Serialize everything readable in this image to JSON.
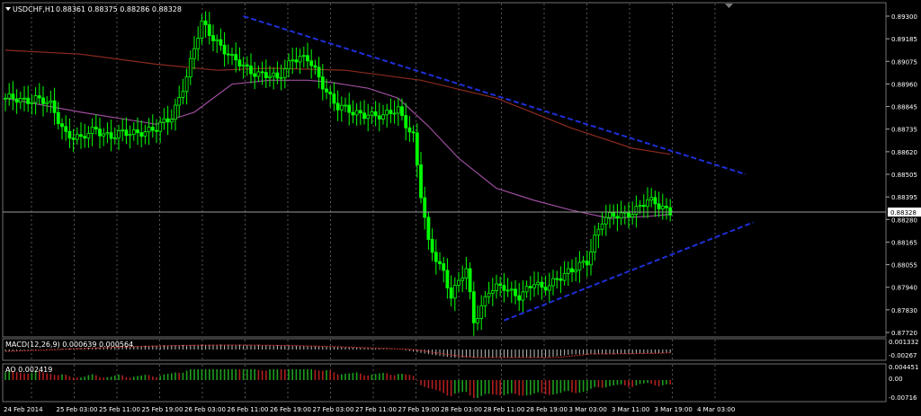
{
  "header": {
    "symbol_label": "USDCHF,H1",
    "ohlc": "0.88361 0.88375 0.88286 0.88328"
  },
  "price_axis": {
    "ticks": [
      "0.89300",
      "0.89185",
      "0.89075",
      "0.88960",
      "0.88845",
      "0.88735",
      "0.88620",
      "0.88505",
      "0.88395",
      "0.88280",
      "0.88165",
      "0.88055",
      "0.87940",
      "0.87830",
      "0.87720"
    ],
    "current_price": "0.88328"
  },
  "time_axis": {
    "ticks": [
      "24 Feb 2014",
      "25 Feb 03:00",
      "25 Feb 11:00",
      "25 Feb 19:00",
      "26 Feb 03:00",
      "26 Feb 11:00",
      "26 Feb 19:00",
      "27 Feb 03:00",
      "27 Feb 11:00",
      "27 Feb 19:00",
      "28 Feb 03:00",
      "28 Feb 11:00",
      "28 Feb 19:00",
      "3 Mar 03:00",
      "3 Mar 11:00",
      "3 Mar 19:00",
      "4 Mar 03:00"
    ]
  },
  "macd": {
    "label": "MACD(12,26,9) 0.000639 0.000564",
    "ticks": [
      "0.001332",
      "-0.00267"
    ]
  },
  "ao": {
    "label": "AO 0.002419",
    "ticks": [
      "0.004451",
      "0.00",
      "-0.00716"
    ]
  },
  "colors": {
    "background": "#000000",
    "bull": "#00ff00",
    "bear": "#00ff00",
    "ma_fast": "#9c4d9c",
    "ma_slow": "#8b2a1f",
    "trendline": "#1f2fd6",
    "grid": "#7a7a7a",
    "text": "#ffffff",
    "macd_hist": "#c0c0c0",
    "macd_signal": "#c0302a",
    "ao_up": "#1e9e1e",
    "ao_down": "#b01e1e"
  },
  "chart_data": {
    "type": "candlestick",
    "symbol": "USDCHF",
    "timeframe": "H1",
    "ylim": [
      0.8772,
      0.893
    ],
    "x": [
      "24 Feb 2014",
      "25 Feb 03:00",
      "25 Feb 11:00",
      "25 Feb 19:00",
      "26 Feb 03:00",
      "26 Feb 11:00",
      "26 Feb 19:00",
      "27 Feb 03:00",
      "27 Feb 11:00",
      "27 Feb 19:00",
      "28 Feb 03:00",
      "28 Feb 11:00",
      "28 Feb 19:00",
      "3 Mar 03:00",
      "3 Mar 11:00",
      "3 Mar 19:00",
      "4 Mar 03:00"
    ],
    "close_path": [
      [
        0,
        0.8888
      ],
      [
        8,
        0.8889
      ],
      [
        12,
        0.8885
      ],
      [
        16,
        0.8872
      ],
      [
        20,
        0.8868
      ],
      [
        24,
        0.8874
      ],
      [
        28,
        0.887
      ],
      [
        32,
        0.8871
      ],
      [
        36,
        0.8873
      ],
      [
        40,
        0.8873
      ],
      [
        44,
        0.888
      ],
      [
        48,
        0.89
      ],
      [
        52,
        0.8926
      ],
      [
        56,
        0.8918
      ],
      [
        60,
        0.8908
      ],
      [
        64,
        0.8904
      ],
      [
        68,
        0.8901
      ],
      [
        72,
        0.8898
      ],
      [
        76,
        0.891
      ],
      [
        80,
        0.8908
      ],
      [
        84,
        0.8896
      ],
      [
        88,
        0.8885
      ],
      [
        92,
        0.8881
      ],
      [
        96,
        0.8882
      ],
      [
        100,
        0.8879
      ],
      [
        104,
        0.8884
      ],
      [
        108,
        0.887
      ],
      [
        110,
        0.884
      ],
      [
        112,
        0.8816
      ],
      [
        116,
        0.8803
      ],
      [
        118,
        0.879
      ],
      [
        122,
        0.8803
      ],
      [
        124,
        0.8778
      ],
      [
        128,
        0.8793
      ],
      [
        132,
        0.8794
      ],
      [
        136,
        0.8791
      ],
      [
        140,
        0.8796
      ],
      [
        142,
        0.8793
      ],
      [
        146,
        0.88
      ],
      [
        150,
        0.8802
      ],
      [
        154,
        0.8808
      ],
      [
        156,
        0.882
      ],
      [
        158,
        0.8828
      ],
      [
        162,
        0.883
      ],
      [
        166,
        0.8833
      ],
      [
        170,
        0.8837
      ],
      [
        174,
        0.8835
      ],
      [
        176,
        0.8833
      ]
    ],
    "ma_fast": [
      [
        0,
        0.8889
      ],
      [
        20,
        0.8882
      ],
      [
        40,
        0.8876
      ],
      [
        50,
        0.8882
      ],
      [
        60,
        0.8896
      ],
      [
        70,
        0.8898
      ],
      [
        80,
        0.8898
      ],
      [
        86,
        0.8897
      ],
      [
        96,
        0.8894
      ],
      [
        104,
        0.8889
      ],
      [
        112,
        0.8875
      ],
      [
        120,
        0.8859
      ],
      [
        130,
        0.8844
      ],
      [
        140,
        0.8838
      ],
      [
        150,
        0.8833
      ],
      [
        160,
        0.8829
      ],
      [
        170,
        0.883
      ],
      [
        176,
        0.8831
      ]
    ],
    "ma_slow": [
      [
        0,
        0.8913
      ],
      [
        20,
        0.8911
      ],
      [
        40,
        0.8906
      ],
      [
        56,
        0.8903
      ],
      [
        70,
        0.8904
      ],
      [
        90,
        0.8903
      ],
      [
        110,
        0.8898
      ],
      [
        130,
        0.8889
      ],
      [
        150,
        0.8874
      ],
      [
        166,
        0.8864
      ],
      [
        176,
        0.8861
      ]
    ],
    "trendlines": [
      {
        "from": [
          63,
          0.893
        ],
        "to": [
          196,
          0.8851
        ]
      },
      {
        "from": [
          132,
          0.8778
        ],
        "to": [
          198,
          0.8827
        ]
      }
    ]
  }
}
